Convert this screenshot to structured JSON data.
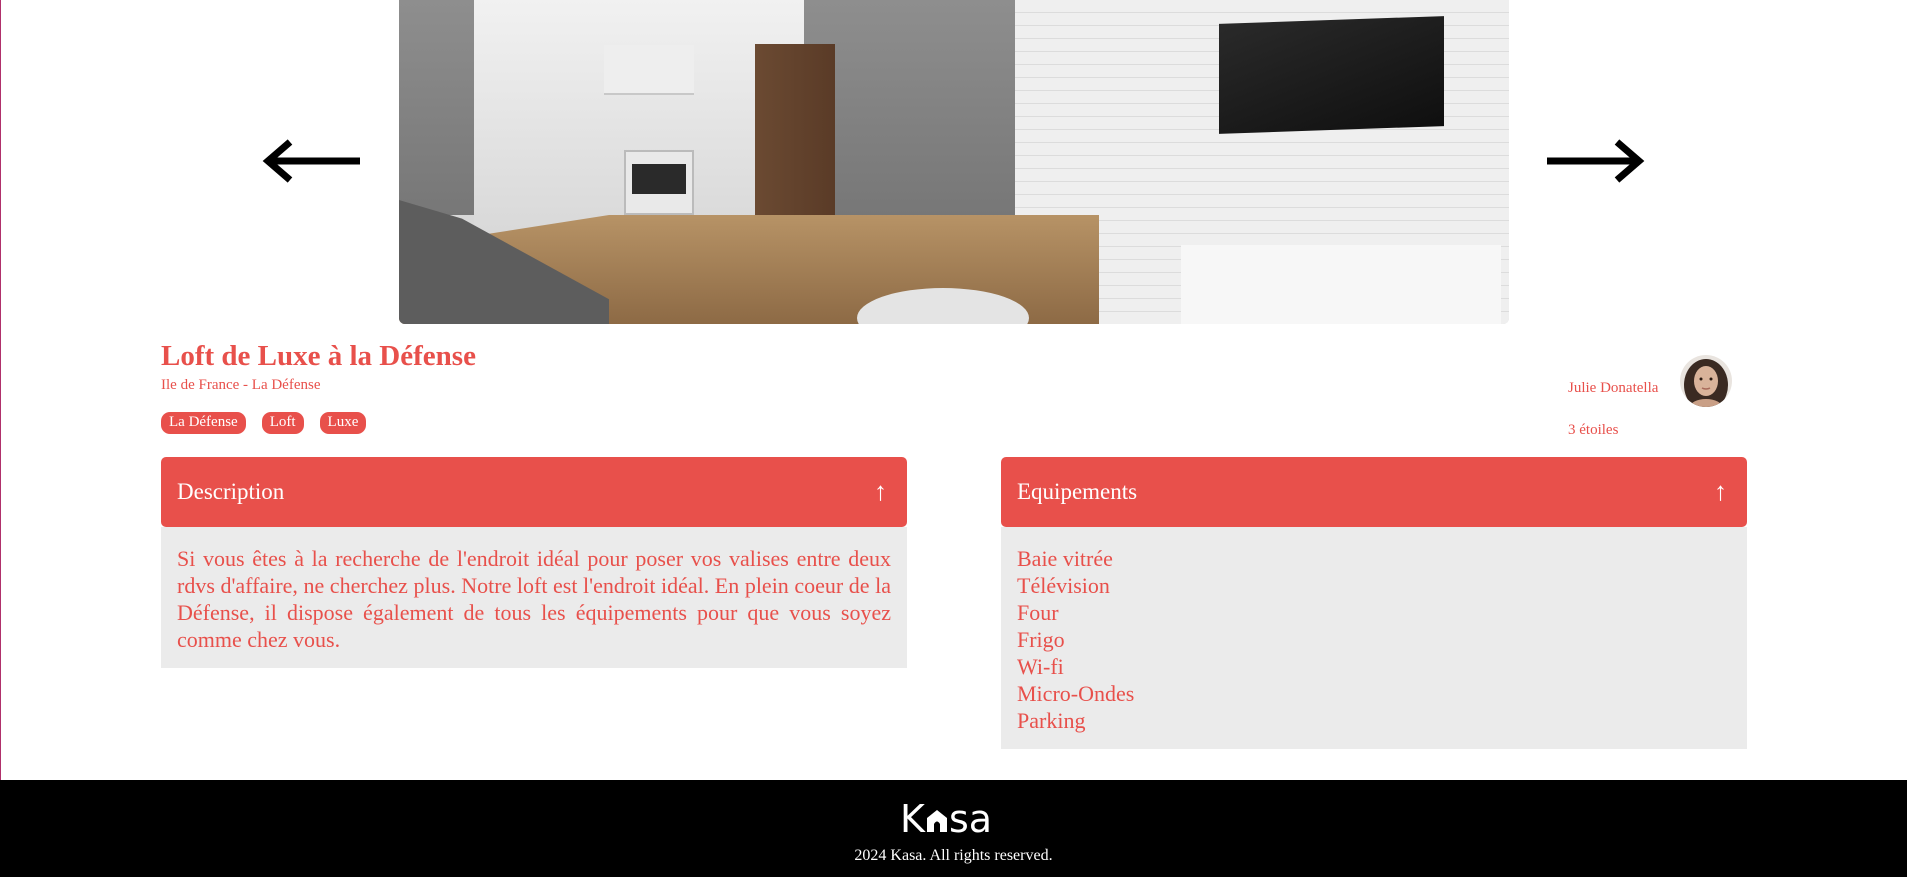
{
  "listing": {
    "title": "Loft de Luxe à la Défense",
    "location": "Ile de France - La Défense",
    "tags": [
      "La Défense",
      "Loft",
      "Luxe"
    ]
  },
  "host": {
    "name": "Julie Donatella",
    "rating_text": "3 étoiles"
  },
  "carousel": {
    "prev_icon": "arrow-left-icon",
    "next_icon": "arrow-right-icon"
  },
  "description": {
    "title": "Description",
    "toggle_icon": "↑",
    "text": "Si vous êtes à la recherche de l'endroit idéal pour poser vos valises entre deux rdvs d'affaire, ne cherchez plus. Notre loft est l'endroit idéal. En plein coeur de la Défense, il dispose également de tous les équipements pour que vous soyez comme chez vous."
  },
  "equipements": {
    "title": "Equipements",
    "toggle_icon": "↑",
    "items": [
      "Baie vitrée",
      "Télévision",
      "Four",
      "Frigo",
      "Wi-fi",
      "Micro-Ondes",
      "Parking"
    ]
  },
  "footer": {
    "logo_text": "Kasa",
    "copyright": "2024 Kasa. All rights reserved."
  },
  "colors": {
    "accent": "#e8504b",
    "panel_bg": "#ebebeb",
    "footer_bg": "#000000"
  }
}
